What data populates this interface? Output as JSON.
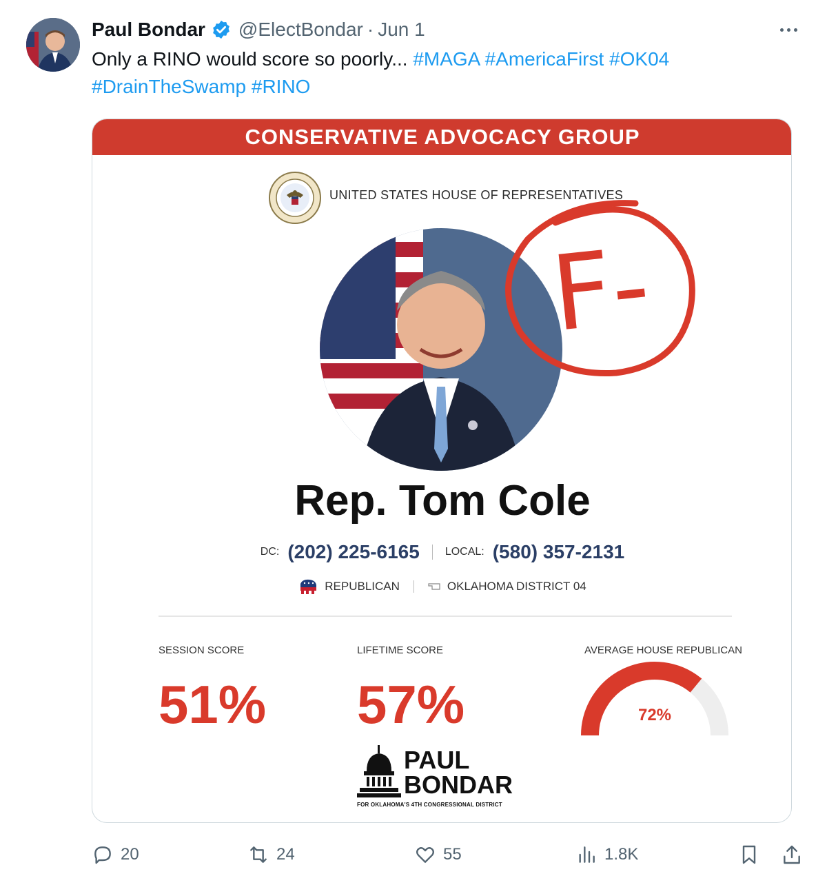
{
  "author": {
    "name": "Paul Bondar",
    "handle": "@ElectBondar",
    "separator": "·",
    "date": "Jun 1"
  },
  "tweet": {
    "text": "Only a RINO would score so poorly...",
    "hashtags": [
      "#MAGA",
      "#AmericaFirst",
      "#OK04",
      "#DrainTheSwamp",
      "#RINO"
    ]
  },
  "card": {
    "banner": "CONSERVATIVE ADVOCACY GROUP",
    "institution": "UNITED STATES HOUSE OF REPRESENTATIVES",
    "grade": "F-",
    "rep_name": "Rep. Tom Cole",
    "dc_label": "DC:",
    "dc_phone": "(202) 225-6165",
    "local_label": "LOCAL:",
    "local_phone": "(580) 357-2131",
    "party": "REPUBLICAN",
    "district": "OKLAHOMA DISTRICT 04",
    "session_label": "SESSION SCORE",
    "session_value": "51%",
    "lifetime_label": "LIFETIME SCORE",
    "lifetime_value": "57%",
    "average_label": "AVERAGE HOUSE REPUBLICAN",
    "average_value": "72%",
    "average_fraction": 0.72,
    "logo_line1": "PAUL",
    "logo_line2": "BONDAR",
    "logo_sub": "FOR OKLAHOMA'S 4TH CONGRESSIONAL DISTRICT"
  },
  "actions": {
    "replies": "20",
    "reposts": "24",
    "likes": "55",
    "views": "1.8K"
  },
  "colors": {
    "brand_red": "#cf3b2e",
    "score_red": "#d93a2b",
    "link_blue": "#1d9bf0",
    "muted": "#536471"
  }
}
